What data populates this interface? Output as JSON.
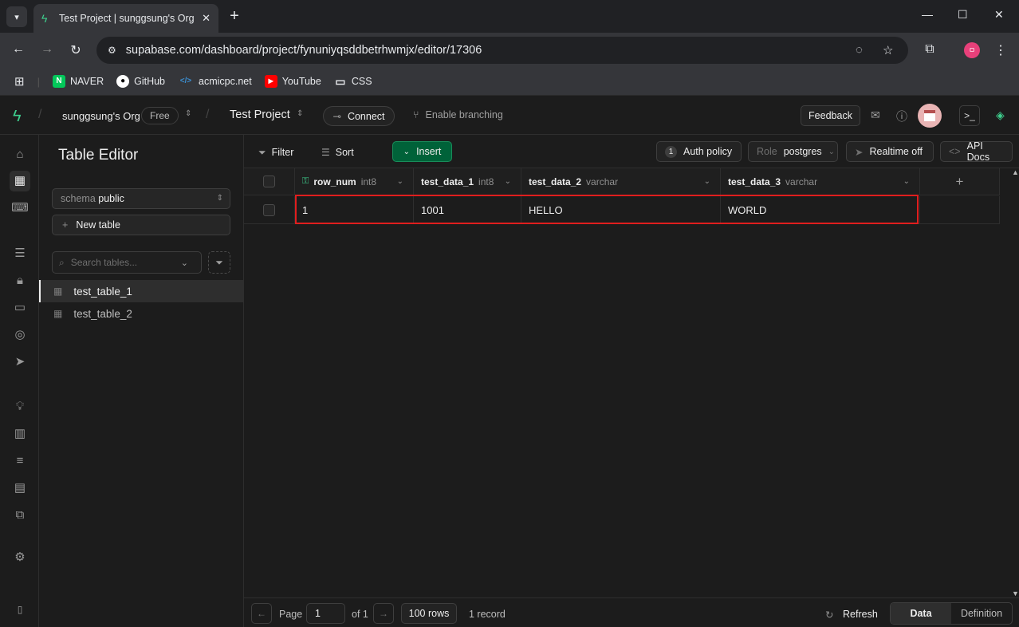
{
  "browser": {
    "tab_title": "Test Project | sunggsung's Org",
    "url_site_icon": "tune-icon",
    "url": "supabase.com/dashboard/project/fynuniyqsddbetrhwmjx/editor/17306",
    "profile_initial": "ㅁ",
    "bookmarks": [
      {
        "label": "NAVER",
        "badge": "N",
        "color": "#03c75a"
      },
      {
        "label": "GitHub",
        "badge": "●",
        "color": "#ffffff"
      },
      {
        "label": "acmicpc.net",
        "badge": "</>",
        "color": "#0076c0"
      },
      {
        "label": "YouTube",
        "badge": "▶",
        "color": "#ff0000"
      },
      {
        "label": "CSS",
        "badge": "▭",
        "color": "#e8eaed"
      }
    ]
  },
  "topbar": {
    "org": "sunggsung's Org",
    "plan": "Free",
    "project": "Test Project",
    "connect": "Connect",
    "branching": "Enable branching",
    "feedback": "Feedback"
  },
  "panel": {
    "title": "Table Editor",
    "schema_label": "schema",
    "schema_value": "public",
    "new_table": "New table",
    "search_placeholder": "Search tables...",
    "tables": [
      "test_table_1",
      "test_table_2"
    ]
  },
  "toolbar": {
    "filter": "Filter",
    "sort": "Sort",
    "insert": "Insert",
    "auth_count": "1",
    "auth_policy": "Auth policy",
    "role_label": "Role",
    "role_value": "postgres",
    "realtime": "Realtime off",
    "api_docs": "API Docs"
  },
  "grid": {
    "columns": [
      {
        "name": "row_num",
        "type": "int8"
      },
      {
        "name": "test_data_1",
        "type": "int8"
      },
      {
        "name": "test_data_2",
        "type": "varchar"
      },
      {
        "name": "test_data_3",
        "type": "varchar"
      }
    ],
    "rows": [
      [
        "1",
        "1001",
        "HELLO",
        "WORLD"
      ]
    ]
  },
  "footer": {
    "page_label": "Page",
    "page_value": "1",
    "of": "of 1",
    "rows": "100 rows",
    "records": "1 record",
    "refresh": "Refresh",
    "data": "Data",
    "definition": "Definition"
  }
}
